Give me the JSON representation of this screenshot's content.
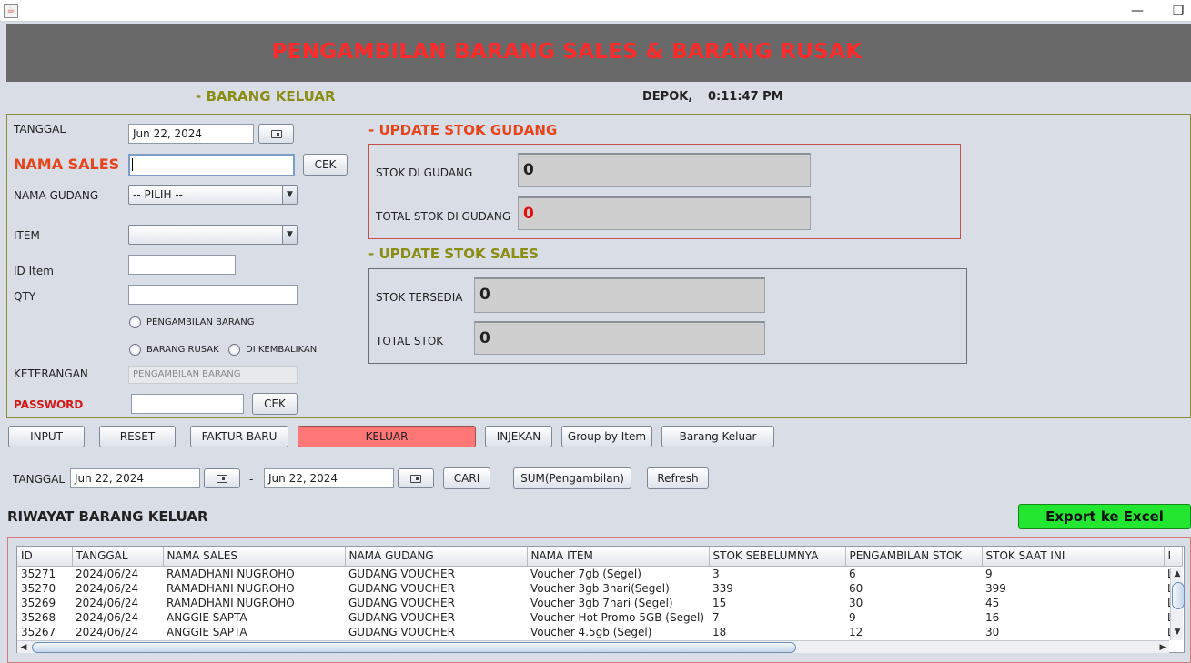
{
  "window": {
    "minimize_glyph": "—",
    "restore_glyph": "❐",
    "app_icon_glyph": "☕"
  },
  "header": {
    "title": "PENGAMBILAN BARANG SALES & BARANG RUSAK"
  },
  "subheader": {
    "section_title": "- BARANG KELUAR",
    "location": "DEPOK,",
    "clock": "0:11:47 PM"
  },
  "form": {
    "tanggal_label": "TANGGAL",
    "tanggal_value": "Jun 22, 2024",
    "nama_sales_label": "NAMA SALES",
    "nama_sales_value": "",
    "cek_label": "CEK",
    "nama_gudang_label": "NAMA GUDANG",
    "nama_gudang_value": "-- PILIH --",
    "item_label": "ITEM",
    "item_value": "",
    "id_item_label": "ID Item",
    "id_item_value": "",
    "qty_label": "QTY",
    "qty_value": "",
    "radio_pengambilan": "PENGAMBILAN BARANG",
    "radio_rusak": "BARANG RUSAK",
    "radio_kembalikan": "DI KEMBALIKAN",
    "keterangan_label": "KETERANGAN",
    "keterangan_value": "PENGAMBILAN BARANG",
    "password_label": "PASSWORD",
    "password_value": "",
    "password_cek_label": "CEK"
  },
  "stok_gudang": {
    "title": "- UPDATE STOK GUDANG",
    "stok_label": "STOK DI GUDANG",
    "stok_value": "0",
    "total_label": "TOTAL STOK DI GUDANG",
    "total_value": "0"
  },
  "stok_sales": {
    "title": "- UPDATE STOK SALES",
    "tersedia_label": "STOK TERSEDIA",
    "tersedia_value": "0",
    "total_label": "TOTAL STOK",
    "total_value": "0"
  },
  "actions": {
    "input": "INPUT",
    "reset": "RESET",
    "faktur_baru": "FAKTUR BARU",
    "keluar": "KELUAR",
    "injekan": "INJEKAN",
    "group_by_item": "Group by Item",
    "barang_keluar": "Barang Keluar"
  },
  "filter": {
    "tanggal_label": "TANGGAL",
    "from_value": "Jun 22, 2024",
    "separator": "-",
    "to_value": "Jun 22, 2024",
    "cari": "CARI",
    "sum": "SUM(Pengambilan)",
    "refresh": "Refresh"
  },
  "history": {
    "title": "RIWAYAT BARANG KELUAR",
    "export": "Export ke Excel",
    "columns": [
      "ID",
      "TANGGAL",
      "NAMA SALES",
      "NAMA GUDANG",
      "NAMA ITEM",
      "STOK SEBELUMNYA",
      "PENGAMBILAN STOK",
      "STOK SAAT INI",
      "I"
    ],
    "rows": [
      [
        "35271",
        "2024/06/24",
        "RAMADHANI NUGROHO",
        "GUDANG VOUCHER",
        "Voucher 7gb (Segel)",
        "3",
        "6",
        "9",
        "L"
      ],
      [
        "35270",
        "2024/06/24",
        "RAMADHANI NUGROHO",
        "GUDANG VOUCHER",
        "Voucher 3gb 3hari(Segel)",
        "339",
        "60",
        "399",
        "L"
      ],
      [
        "35269",
        "2024/06/24",
        "RAMADHANI NUGROHO",
        "GUDANG VOUCHER",
        "Voucher 3gb 7hari (Segel)",
        "15",
        "30",
        "45",
        "L"
      ],
      [
        "35268",
        "2024/06/24",
        "ANGGIE SAPTA",
        "GUDANG VOUCHER",
        "Voucher Hot Promo 5GB (Segel)",
        "7",
        "9",
        "16",
        "L"
      ],
      [
        "35267",
        "2024/06/24",
        "ANGGIE SAPTA",
        "GUDANG VOUCHER",
        "Voucher 4.5gb (Segel)",
        "18",
        "12",
        "30",
        "L"
      ]
    ]
  },
  "colors": {
    "banner": "#696969",
    "title_red": "#ff2b2b",
    "section_olive": "#8a8d12",
    "section_orange": "#e8441c",
    "keluar_button": "#ff7676",
    "export_button": "#22e630"
  }
}
